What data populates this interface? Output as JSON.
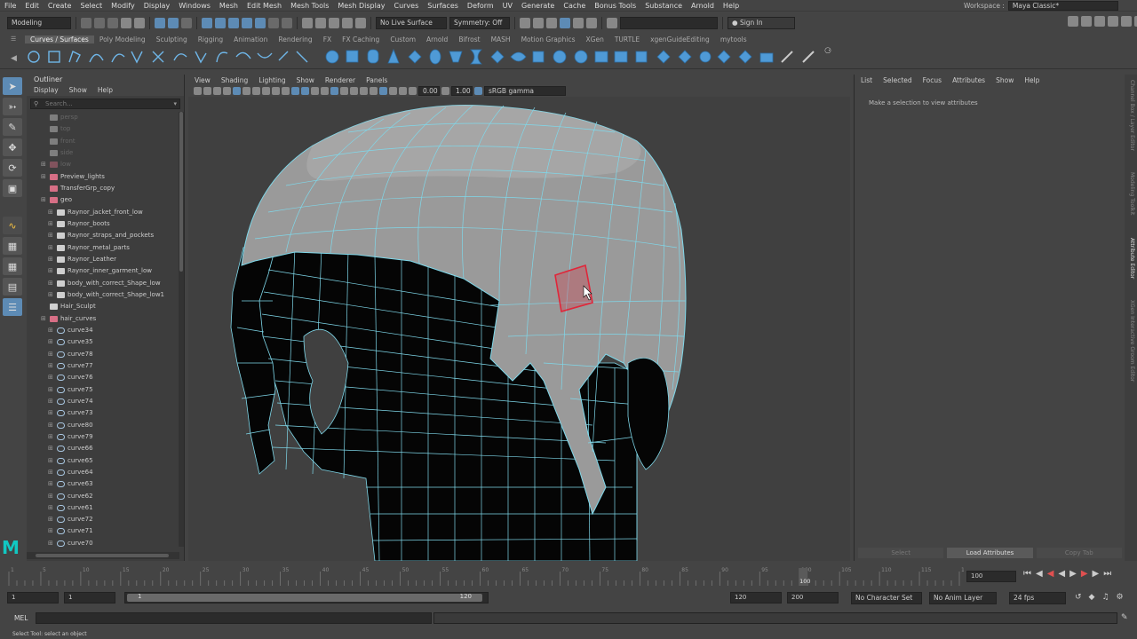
{
  "menubar": [
    "File",
    "Edit",
    "Create",
    "Select",
    "Modify",
    "Display",
    "Windows",
    "Mesh",
    "Edit Mesh",
    "Mesh Tools",
    "Mesh Display",
    "Curves",
    "Surfaces",
    "Deform",
    "UV",
    "Generate",
    "Cache",
    "Bonus Tools",
    "Substance",
    "Arnold",
    "Help"
  ],
  "workspace": {
    "label": "Workspace :",
    "value": "Maya Classic*"
  },
  "status": {
    "mode": "Modeling",
    "live_surface": "No Live Surface",
    "symmetry": "Symmetry: Off",
    "sign_in": "Sign In"
  },
  "shelf_tabs": [
    "Curves / Surfaces",
    "Poly Modeling",
    "Sculpting",
    "Rigging",
    "Animation",
    "Rendering",
    "FX",
    "FX Caching",
    "Custom",
    "Arnold",
    "Bifrost",
    "MASH",
    "Motion Graphics",
    "XGen",
    "TURTLE",
    "xgenGuideEditing",
    "mytools"
  ],
  "shelf_active": "Curves / Surfaces",
  "outliner": {
    "title": "Outliner",
    "menu": [
      "Display",
      "Show",
      "Help"
    ],
    "search_placeholder": "Search...",
    "items": [
      {
        "name": "persp",
        "type": "camera",
        "level": 1,
        "dim": true,
        "expandable": false
      },
      {
        "name": "top",
        "type": "camera",
        "level": 1,
        "dim": true,
        "expandable": false
      },
      {
        "name": "front",
        "type": "camera",
        "level": 1,
        "dim": true,
        "expandable": false
      },
      {
        "name": "side",
        "type": "camera",
        "level": 1,
        "dim": true,
        "expandable": false
      },
      {
        "name": "low",
        "type": "group",
        "level": 1,
        "dim": true,
        "expandable": true
      },
      {
        "name": "Preview_lights",
        "type": "group",
        "level": 1,
        "dim": false,
        "expandable": true
      },
      {
        "name": "TransferGrp_copy",
        "type": "group",
        "level": 1,
        "dim": false,
        "expandable": false
      },
      {
        "name": "geo",
        "type": "group",
        "level": 1,
        "dim": false,
        "expandable": true
      },
      {
        "name": "Raynor_jacket_front_low",
        "type": "mesh",
        "level": 2,
        "dim": false,
        "expandable": true
      },
      {
        "name": "Raynor_boots",
        "type": "mesh",
        "level": 2,
        "dim": false,
        "expandable": true
      },
      {
        "name": "Raynor_straps_and_pockets",
        "type": "mesh",
        "level": 2,
        "dim": false,
        "expandable": true
      },
      {
        "name": "Raynor_metal_parts",
        "type": "mesh",
        "level": 2,
        "dim": false,
        "expandable": true
      },
      {
        "name": "Raynor_Leather",
        "type": "mesh",
        "level": 2,
        "dim": false,
        "expandable": true
      },
      {
        "name": "Raynor_inner_garment_low",
        "type": "mesh",
        "level": 2,
        "dim": false,
        "expandable": true
      },
      {
        "name": "body_with_correct_Shape_low",
        "type": "mesh",
        "level": 2,
        "dim": false,
        "expandable": true
      },
      {
        "name": "body_with_correct_Shape_low1",
        "type": "mesh",
        "level": 2,
        "dim": false,
        "expandable": true
      },
      {
        "name": "Hair_Sculpt",
        "type": "mesh",
        "level": 1,
        "dim": false,
        "expandable": false
      },
      {
        "name": "hair_curves",
        "type": "group",
        "level": 1,
        "dim": false,
        "expandable": true
      },
      {
        "name": "curve34",
        "type": "curve",
        "level": 2,
        "dim": false,
        "expandable": true
      },
      {
        "name": "curve35",
        "type": "curve",
        "level": 2,
        "dim": false,
        "expandable": true
      },
      {
        "name": "curve78",
        "type": "curve",
        "level": 2,
        "dim": false,
        "expandable": true
      },
      {
        "name": "curve77",
        "type": "curve",
        "level": 2,
        "dim": false,
        "expandable": true
      },
      {
        "name": "curve76",
        "type": "curve",
        "level": 2,
        "dim": false,
        "expandable": true
      },
      {
        "name": "curve75",
        "type": "curve",
        "level": 2,
        "dim": false,
        "expandable": true
      },
      {
        "name": "curve74",
        "type": "curve",
        "level": 2,
        "dim": false,
        "expandable": true
      },
      {
        "name": "curve73",
        "type": "curve",
        "level": 2,
        "dim": false,
        "expandable": true
      },
      {
        "name": "curve80",
        "type": "curve",
        "level": 2,
        "dim": false,
        "expandable": true
      },
      {
        "name": "curve79",
        "type": "curve",
        "level": 2,
        "dim": false,
        "expandable": true
      },
      {
        "name": "curve66",
        "type": "curve",
        "level": 2,
        "dim": false,
        "expandable": true
      },
      {
        "name": "curve65",
        "type": "curve",
        "level": 2,
        "dim": false,
        "expandable": true
      },
      {
        "name": "curve64",
        "type": "curve",
        "level": 2,
        "dim": false,
        "expandable": true
      },
      {
        "name": "curve63",
        "type": "curve",
        "level": 2,
        "dim": false,
        "expandable": true
      },
      {
        "name": "curve62",
        "type": "curve",
        "level": 2,
        "dim": false,
        "expandable": true
      },
      {
        "name": "curve61",
        "type": "curve",
        "level": 2,
        "dim": false,
        "expandable": true
      },
      {
        "name": "curve72",
        "type": "curve",
        "level": 2,
        "dim": false,
        "expandable": true
      },
      {
        "name": "curve71",
        "type": "curve",
        "level": 2,
        "dim": false,
        "expandable": true
      },
      {
        "name": "curve70",
        "type": "curve",
        "level": 2,
        "dim": false,
        "expandable": true
      }
    ]
  },
  "viewport": {
    "menu": [
      "View",
      "Shading",
      "Lighting",
      "Show",
      "Renderer",
      "Panels"
    ],
    "field_a": "0.00",
    "field_b": "1.00",
    "color_space": "sRGB gamma"
  },
  "attribute_editor": {
    "menu": [
      "List",
      "Selected",
      "Focus",
      "Attributes",
      "Show",
      "Help"
    ],
    "message": "Make a selection to view attributes",
    "buttons": [
      "Select",
      "Load Attributes",
      "Copy Tab"
    ]
  },
  "side_tabs": [
    "Channel Box / Layer Editor",
    "Modeling Toolkit",
    "Attribute Editor",
    "XGen Interactive Groom Editor"
  ],
  "timeline": {
    "ticks": [
      "1",
      "5",
      "10",
      "15",
      "20",
      "25",
      "30",
      "35",
      "40",
      "45",
      "50",
      "55",
      "60",
      "65",
      "70",
      "75",
      "80",
      "85",
      "90",
      "95",
      "100",
      "105",
      "110",
      "115",
      "120"
    ],
    "current_frame": "100",
    "current_frame_field": "100"
  },
  "range": {
    "start": "1",
    "inner_start": "1",
    "slider_start": "1",
    "slider_end": "120",
    "end": "120",
    "outer_end": "200",
    "character_set": "No Character Set",
    "anim_layer": "No Anim Layer",
    "fps": "24 fps"
  },
  "command": {
    "lang": "MEL"
  },
  "help_line": "Select Tool: select an object",
  "colors": {
    "wire": "#7fd8ea",
    "selection": "#e0263a",
    "accent": "#5d8bb5"
  }
}
